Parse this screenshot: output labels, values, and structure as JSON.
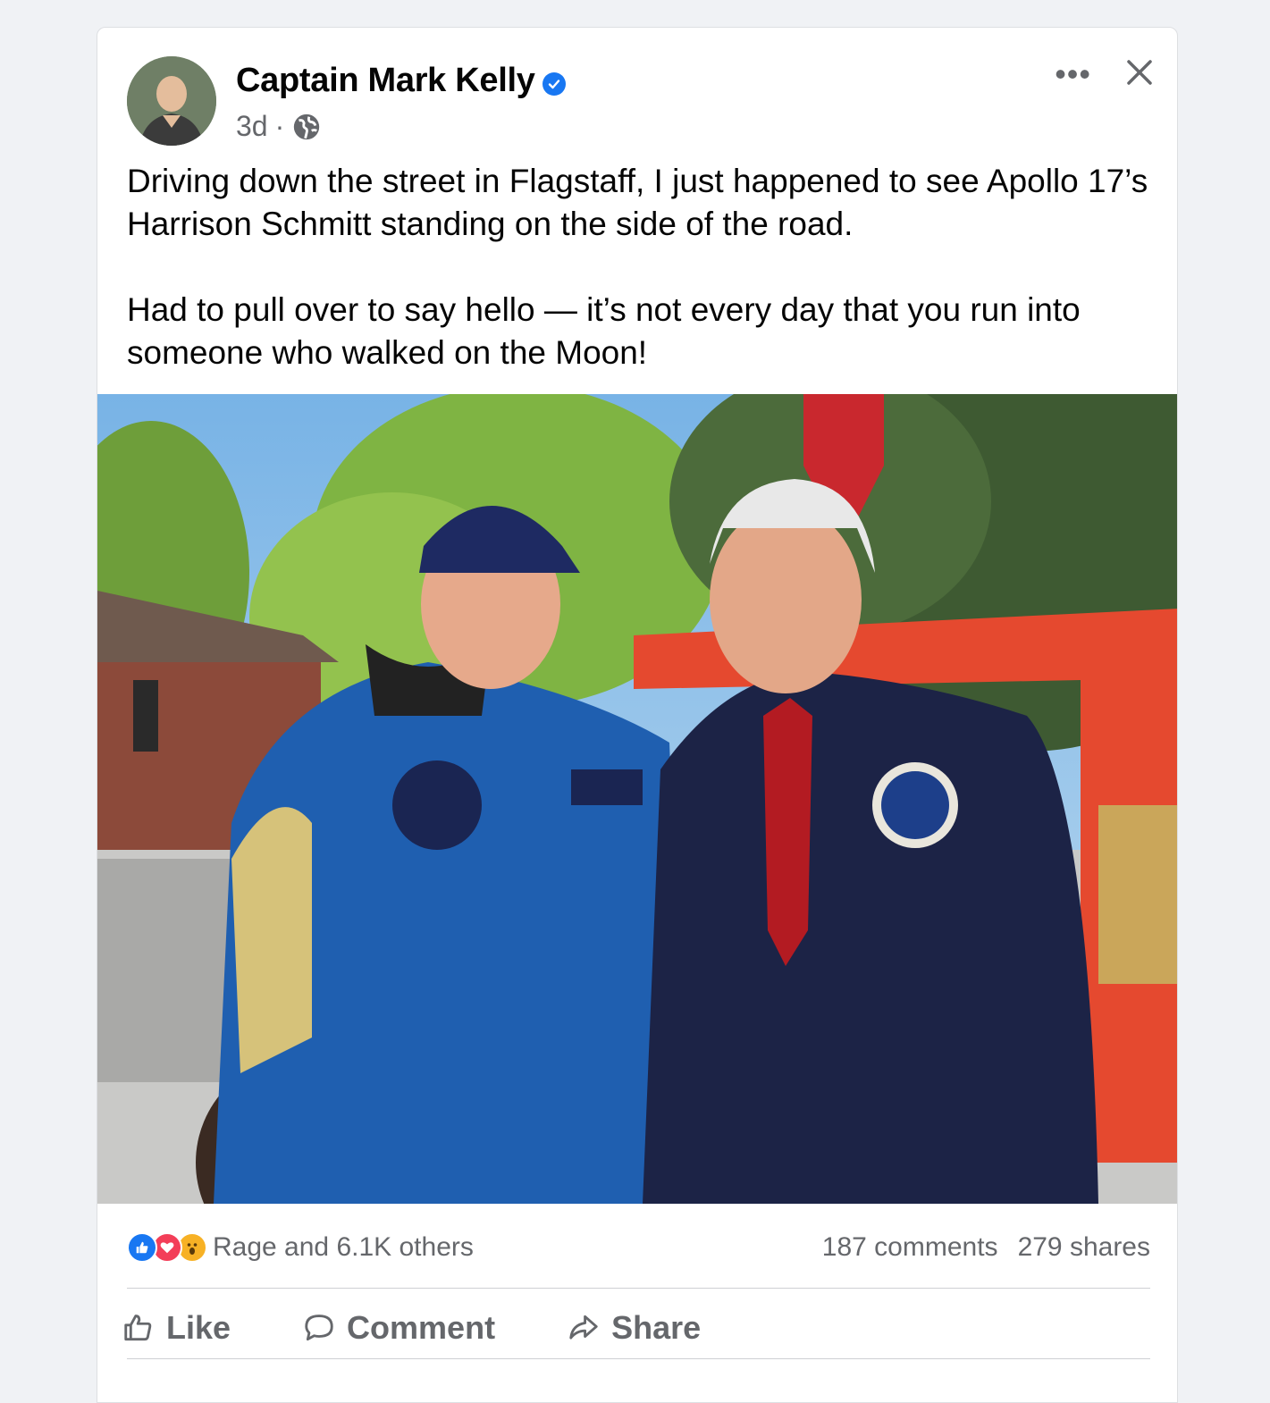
{
  "post": {
    "author": "Captain Mark Kelly",
    "time": "3d",
    "separator": "·",
    "privacy_icon": "globe-icon",
    "more_icon": "more-icon",
    "close_icon": "close-icon",
    "text_p1": "Driving down the street in Flagstaff, I just happened to see Apollo 17’s Harrison Schmitt standing on the side of the road.",
    "text_p2": "Had to pull over to say hello — it’s not every day that you run into someone who walked on the Moon!",
    "photo_icon": "photo"
  },
  "stats": {
    "reaction_icons": [
      "like-icon",
      "love-icon",
      "wow-icon"
    ],
    "reactions_text": "Rage and 6.1K others",
    "comments": "187 comments",
    "shares": "279 shares"
  },
  "actions": {
    "like": "Like",
    "comment": "Comment",
    "share": "Share"
  },
  "colors": {
    "brand_blue": "#1877f2",
    "secondary_text": "#65676b",
    "love_red": "#f33e58",
    "wow_yellow": "#f7b125"
  }
}
